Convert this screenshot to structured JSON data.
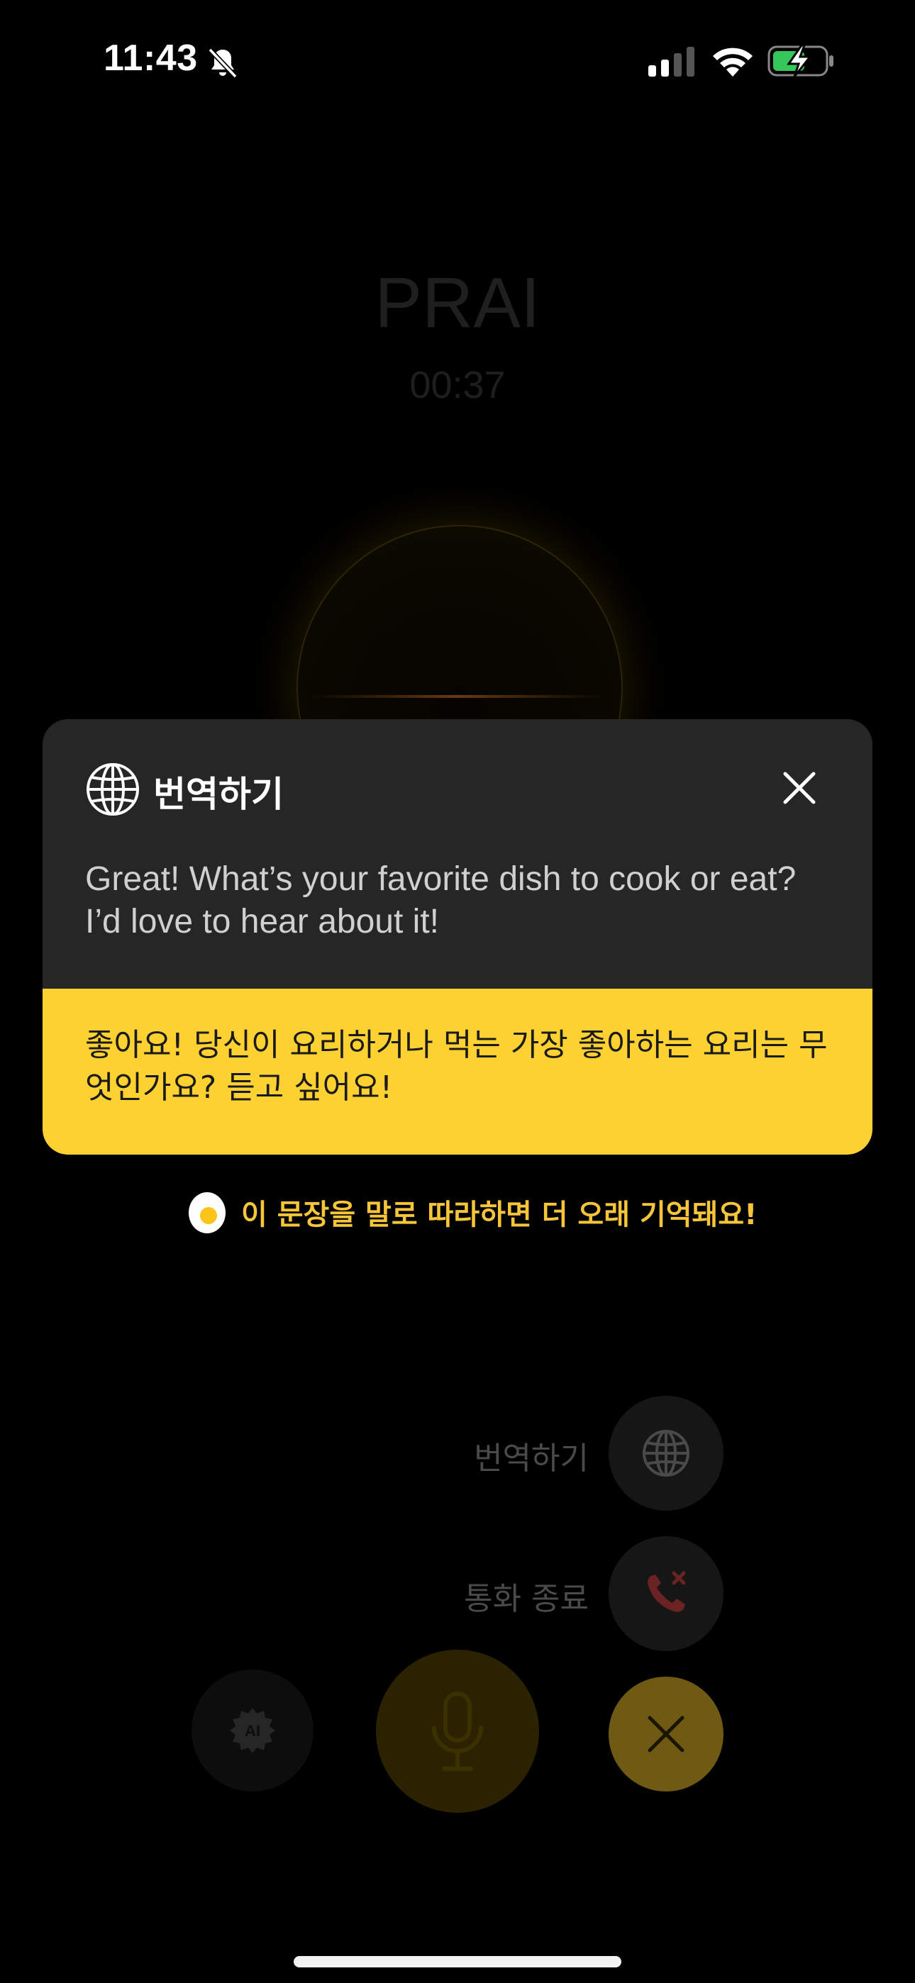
{
  "status_bar": {
    "time": "11:43",
    "icons": [
      "bell-slash-icon",
      "cellular-signal-icon",
      "wifi-icon",
      "battery-charging-icon"
    ]
  },
  "call": {
    "name": "PRAI",
    "timer": "00:37"
  },
  "translate_card": {
    "title": "번역하기",
    "original_text": "Great! What’s your favorite dish to cook or eat? I’d love to hear about it!",
    "translated_text": "좋아요! 당신이 요리하거나 먹는 가장 좋아하는 요리는 무엇인가요? 듣고 싶어요!",
    "icons": [
      "globe-icon",
      "close-icon"
    ]
  },
  "tip": {
    "text": "이 문장을 말로 따라하면 더 오래 기억돼요!",
    "icon": "egg-icon"
  },
  "menu": {
    "translate_label": "번역하기",
    "end_call_label": "통화 종료"
  },
  "colors": {
    "accent_yellow": "#fdd131",
    "card_background": "#262626",
    "tip_text": "#f6c53a"
  }
}
